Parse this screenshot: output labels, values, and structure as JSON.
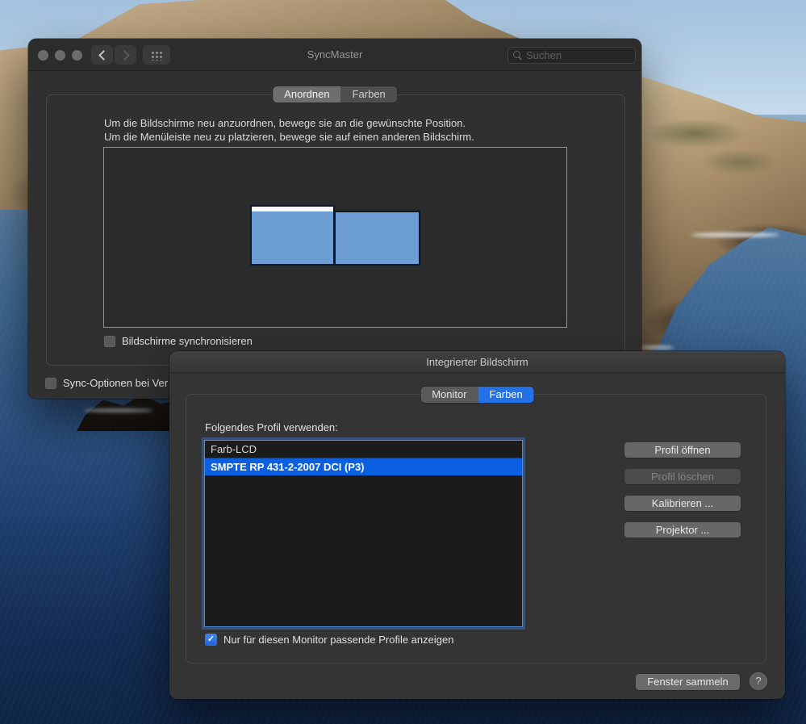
{
  "wallpaper": {
    "sky_top": "#a3c2de",
    "sky_bottom": "#c9dcec",
    "ocean_near_horizon": "#8fb0c7",
    "ocean_deep": "#0f2546",
    "cliff_light": "#cdb892",
    "cliff_dark": "#3a2f24",
    "vegetation": "#55603a",
    "surf": "#e8f0f5"
  },
  "back_window": {
    "title": "SyncMaster",
    "toolbar": {
      "search_placeholder": "Suchen"
    },
    "tabs": [
      {
        "label": "Anordnen",
        "selected": true
      },
      {
        "label": "Farben",
        "selected": false
      }
    ],
    "instructions": {
      "line1": "Um die Bildschirme neu anzuordnen, bewege sie an die gewünschte Position.",
      "line2": "Um die Menüleiste neu zu platzieren, bewege sie auf einen anderen Bildschirm."
    },
    "mirror_checkbox": {
      "label": "Bildschirme synchronisieren",
      "checked": false
    },
    "sync_options_checkbox": {
      "label": "Sync-Optionen bei Ver",
      "checked": false
    }
  },
  "front_window": {
    "title": "Integrierter Bildschirm",
    "tabs": [
      {
        "label": "Monitor",
        "selected": false
      },
      {
        "label": "Farben",
        "selected": true
      }
    ],
    "profile_section": {
      "label": "Folgendes Profil verwenden:",
      "profiles": [
        {
          "name": "Farb-LCD",
          "selected": false
        },
        {
          "name": "SMPTE RP 431-2-2007 DCI (P3)",
          "selected": true
        }
      ]
    },
    "buttons": [
      {
        "label": "Profil öffnen",
        "enabled": true
      },
      {
        "label": "Profil löschen",
        "enabled": false
      },
      {
        "label": "Kalibrieren ...",
        "enabled": true
      },
      {
        "label": "Projektor ...",
        "enabled": true
      }
    ],
    "filter_checkbox": {
      "label": "Nur für diesen Monitor passende Profile anzeigen",
      "checked": true
    },
    "gather_button_label": "Fenster sammeln",
    "help_label": "?"
  },
  "icons": {
    "checkmark": "✓"
  },
  "colors": {
    "accent_blue": "#2271e6",
    "selection_blue": "#0a60e0",
    "display_blue": "#6c9ed4"
  }
}
